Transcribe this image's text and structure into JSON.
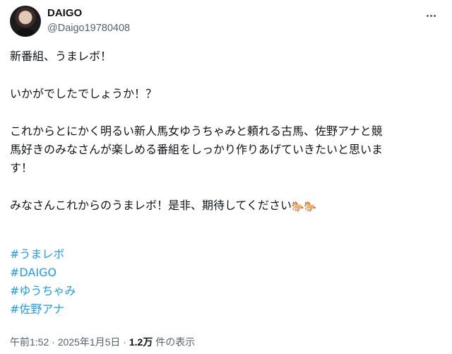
{
  "author": {
    "name": "DAIGO",
    "handle": "@Daigo19780408"
  },
  "tweet": {
    "line1": "新番組、うまレボ！",
    "line2": "いかがでしたでしょうか！？",
    "line3": "これからとにかく明るい新人馬女ゆうちゃみと頼れる古馬、佐野アナと競",
    "line4": "馬好きのみなさんが楽しめる番組をしっかり作りあげていきたいと思いま",
    "line5": "す！",
    "line6": "みなさんこれからのうまレボ！是非、期待してください",
    "emoji": "🐎🐎",
    "hashtags": [
      "#うまレボ",
      "#DAIGO",
      "#ゆうちゃみ",
      "#佐野アナ"
    ]
  },
  "meta": {
    "time": "午前1:52",
    "sep1": " · ",
    "date": "2025年1月5日",
    "sep2": " · ",
    "views": "1.2万",
    "views_label": " 件の表示"
  },
  "icons": {
    "more": "more-horizontal-icon",
    "emoji": "horse-emoji-icon"
  },
  "colors": {
    "text": "#0f1419",
    "secondary": "#536471",
    "link": "#1d9bf0"
  }
}
